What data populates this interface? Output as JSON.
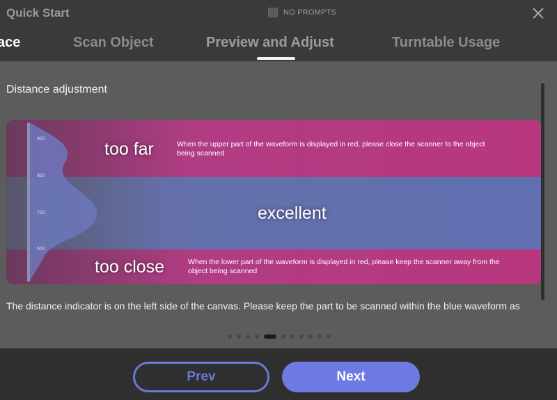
{
  "window": {
    "title": "Quick Start"
  },
  "prompt_toggle": {
    "label": "NO PROMPTS",
    "checked": false
  },
  "tabs": [
    {
      "label": "ace",
      "active": false
    },
    {
      "label": "Scan Object",
      "active": false
    },
    {
      "label": "Preview and Adjust",
      "active": true
    },
    {
      "label": "Turntable Usage",
      "active": false
    }
  ],
  "section": {
    "title": "Distance adjustment",
    "description": "The distance indicator is on the left side of the canvas. Please keep the part to be scanned within the blue waveform as"
  },
  "illustration": {
    "scale_ticks": [
      "900",
      "800",
      "700",
      "600"
    ],
    "too_far": {
      "label": "too far",
      "text": "When the upper part of the waveform is displayed in red, please close the scanner to the object being scanned"
    },
    "excellent": {
      "label": "excellent"
    },
    "too_close": {
      "label": "too close",
      "text": "When the lower part of the waveform is displayed in red, please keep the scanner away from the object being scanned"
    },
    "colors": {
      "red_band": "#b8377e",
      "blue_band": "#5f6fb0"
    }
  },
  "pagination": {
    "total": 11,
    "current": 5
  },
  "buttons": {
    "prev": "Prev",
    "next": "Next"
  },
  "colors": {
    "accent": "#6d7ae2"
  }
}
